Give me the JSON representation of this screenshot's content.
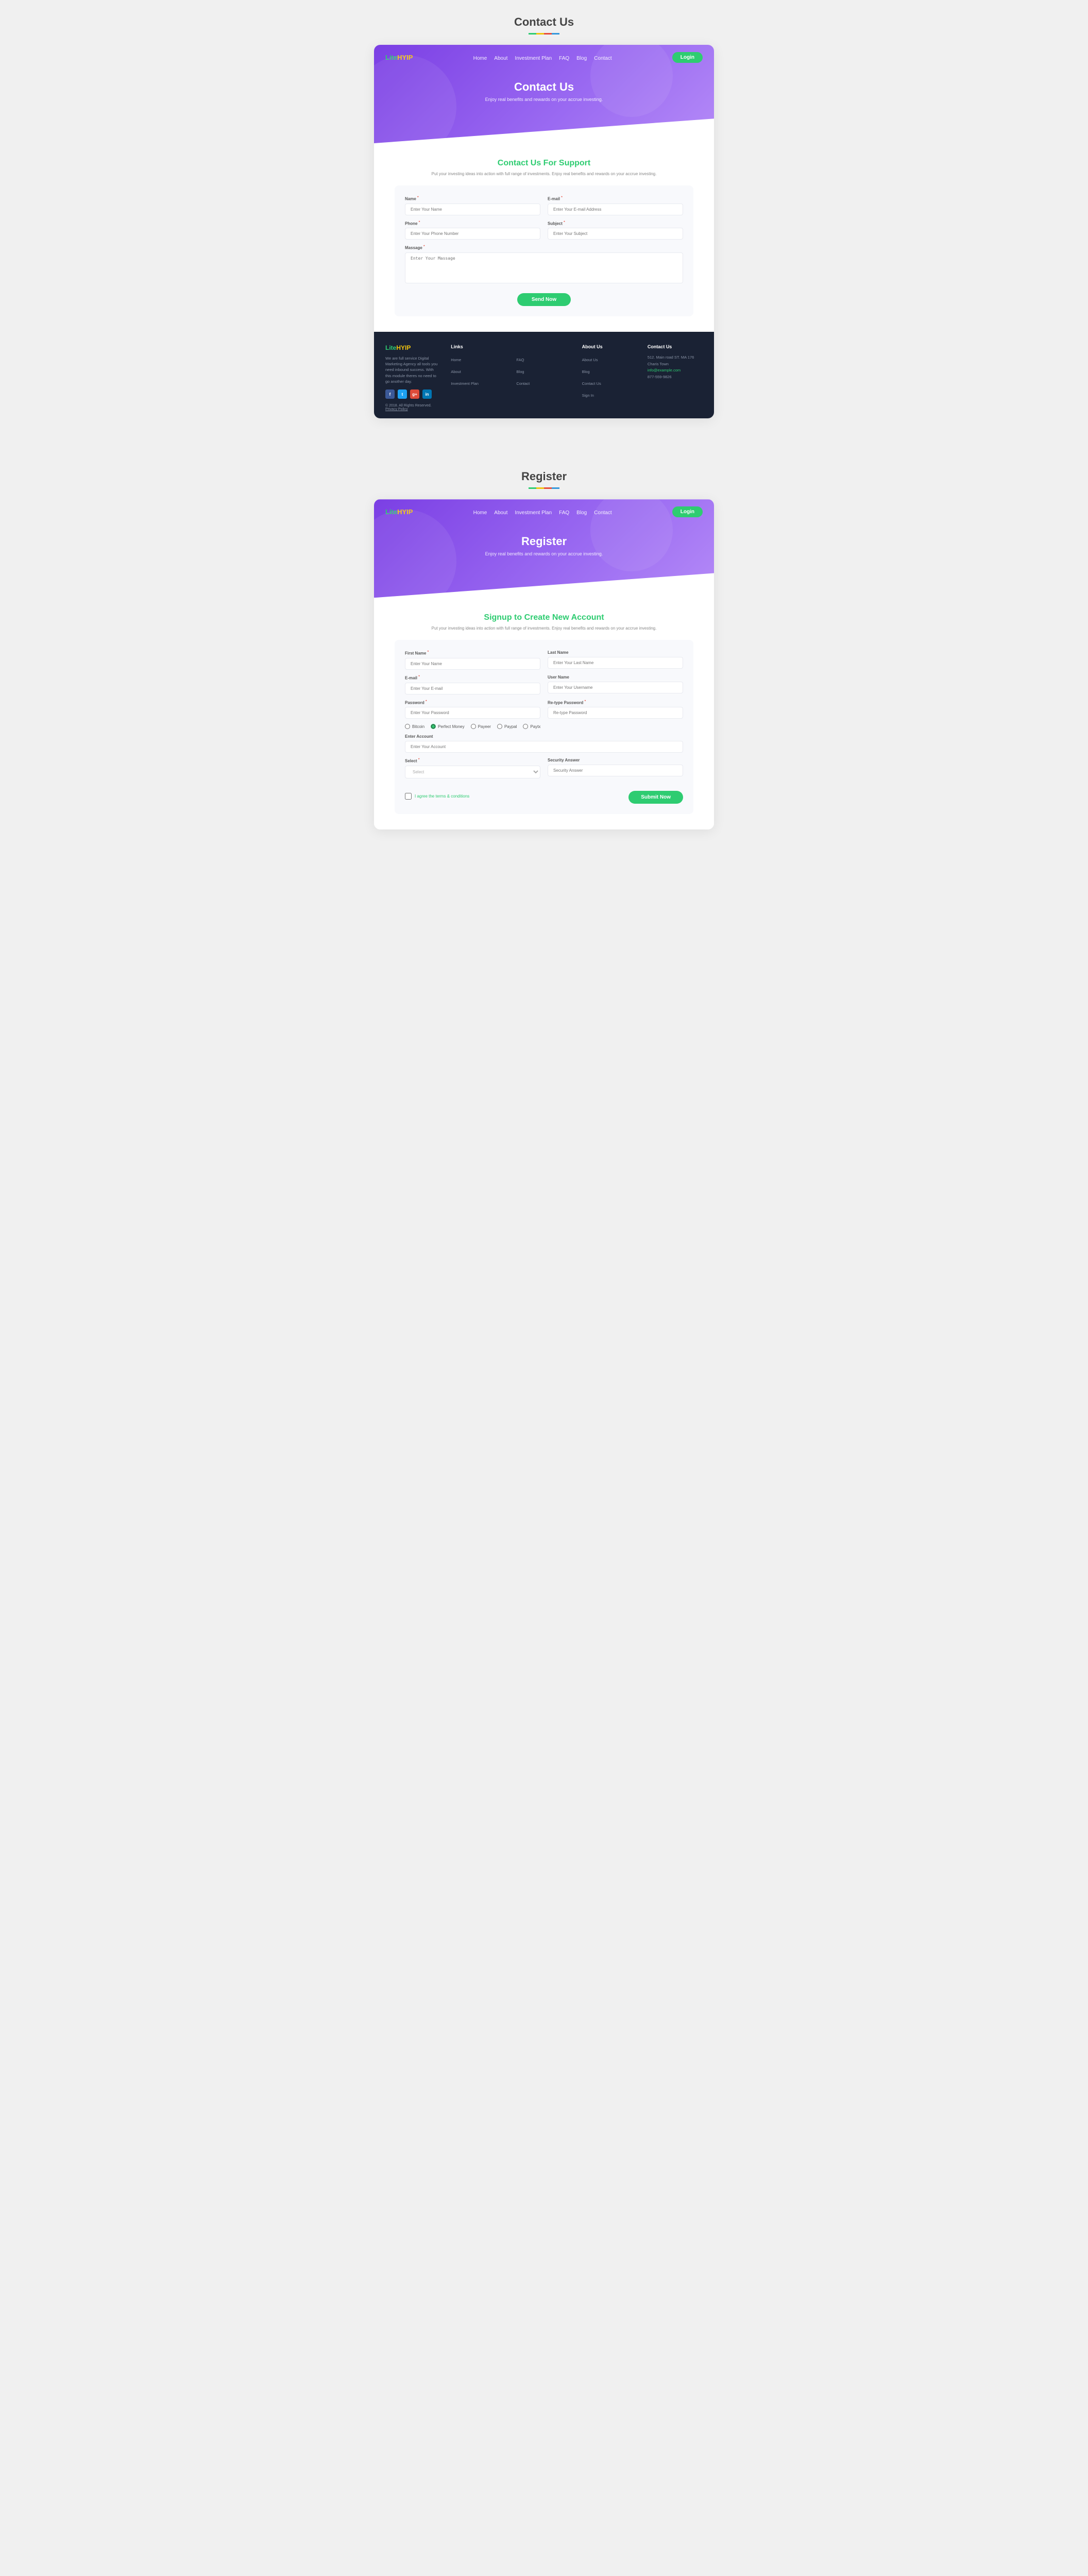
{
  "contact_page": {
    "page_title": "Contact Us",
    "navbar": {
      "logo_lite": "Lite",
      "logo_hyip": "HYIP",
      "links": [
        "Home",
        "About",
        "Investment Plan",
        "FAQ",
        "Blog",
        "Contact"
      ],
      "login_label": "Login"
    },
    "hero": {
      "title": "Contact Us",
      "subtitle": "Enjoy real benefits and rewards on  your accrue investing."
    },
    "section": {
      "heading": "Contact Us For ",
      "heading_accent": "Support",
      "description": "Put your investing ideas into action with full range of  investments. Enjoy real benefits\nand rewards on your accrue investing."
    },
    "form": {
      "name_label": "Name",
      "name_placeholder": "Enter Your Name",
      "email_label": "E-mail",
      "email_placeholder": "Enter Your E-mail Address",
      "phone_label": "Phone",
      "phone_placeholder": "Enter Your Phone Number",
      "subject_label": "Subject",
      "subject_placeholder": "Enter Your Subject",
      "message_label": "Massage",
      "message_placeholder": "Enter Your Massage",
      "send_button": "Send Now"
    },
    "footer": {
      "logo_lite": "Lite",
      "logo_hyip": "HYIP",
      "description": "We are full service Digital Marketing Agency all tools you need inbound success. With this module theres no need to go another day.",
      "social": [
        "f",
        "t",
        "g+",
        "in"
      ],
      "copyright": "© 2018. All Rights Reserved.",
      "privacy_link": "Privacy Policy",
      "columns": {
        "links": {
          "title": "Links",
          "items": [
            "Home",
            "About",
            "Investment Plan"
          ]
        },
        "faq_items": [
          "FAQ",
          "Blog",
          "Contact"
        ],
        "about_us": {
          "title": "About Us",
          "items": [
            "About Us",
            "Blog",
            "Contact Us",
            "Sign In"
          ]
        },
        "contact_us": {
          "title": "Contact Us",
          "address": "512. Main road ST. MA 176",
          "city": "Charis Town",
          "email": "info@example.com",
          "phone": "877-559-9826"
        }
      }
    }
  },
  "register_page": {
    "page_title": "Register",
    "navbar": {
      "logo_lite": "Lite",
      "logo_hyip": "HYIP",
      "links": [
        "Home",
        "About",
        "Investment Plan",
        "FAQ",
        "Blog",
        "Contact"
      ],
      "login_label": "Login"
    },
    "hero": {
      "title": "Register",
      "subtitle": "Enjoy real benefits and rewards on  your accrue investing."
    },
    "section": {
      "heading": "Signup to ",
      "heading_accent": "Create New Account",
      "description": "Put your investing ideas into action with full range of  investments. Enjoy real benefits\nand rewards on your accrue investing."
    },
    "form": {
      "first_name_label": "First Name",
      "first_name_placeholder": "Enter Your Name",
      "last_name_label": "Last Name",
      "last_name_placeholder": "Enter Your Last Name",
      "email_label": "E-mail",
      "email_placeholder": "Enter Your E-mail",
      "username_label": "User Name",
      "username_placeholder": "Enter Your Username",
      "password_label": "Password",
      "password_placeholder": "Enter Your Password",
      "retype_password_label": "Re-type Password",
      "retype_password_placeholder": "Re-type Password",
      "payment_options": [
        "Bitcoin",
        "Perfect Money",
        "Payeer",
        "Paypal",
        "Paytx"
      ],
      "enter_account_label": "Enter Account",
      "enter_account_placeholder": "Enter Your Account",
      "select_label": "Select",
      "select_placeholder": "Select",
      "security_answer_label": "Security Answer",
      "security_answer_placeholder": "Security Answer",
      "agree_label": "I agree the terms & conditions",
      "submit_button": "Submit Now"
    }
  }
}
